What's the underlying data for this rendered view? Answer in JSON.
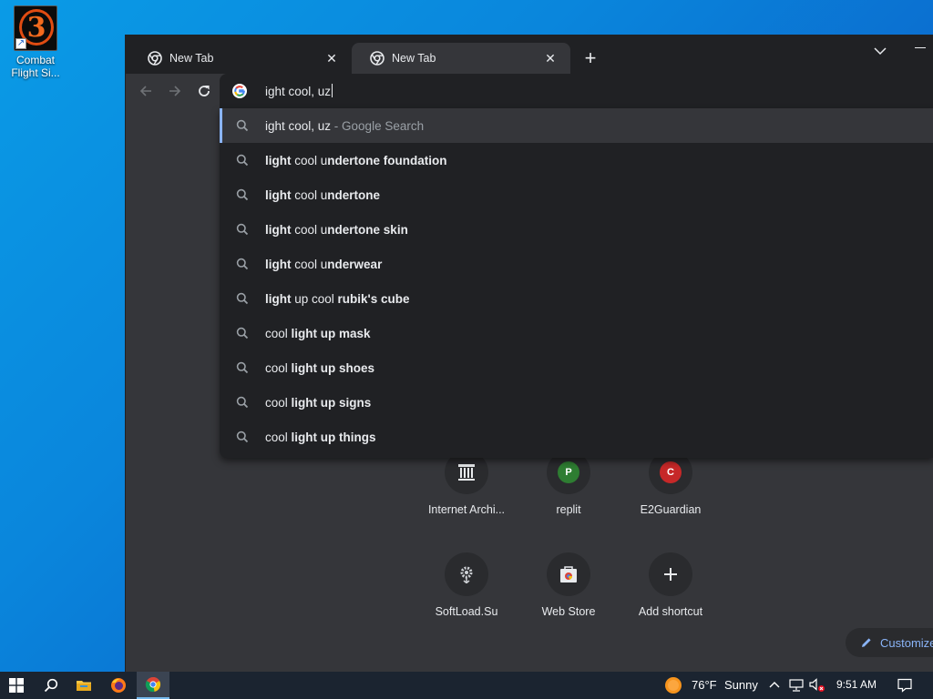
{
  "desktop": {
    "icon": {
      "glyph": "3",
      "label": "Combat Flight Si..."
    }
  },
  "tabs": [
    {
      "title": "New Tab",
      "active": false
    },
    {
      "title": "New Tab",
      "active": true
    }
  ],
  "tabstrip": {
    "new_tab_glyph": "+",
    "close_glyph": "✕"
  },
  "omnibox": {
    "value": "ight cool, uz"
  },
  "suggestions": {
    "first": {
      "query": "ight cool, uz",
      "suffix": " - Google Search"
    },
    "items": [
      {
        "parts": [
          [
            "light",
            true
          ],
          [
            " cool ",
            false
          ],
          [
            "u",
            false
          ],
          [
            "ndertone foundation",
            true
          ]
        ]
      },
      {
        "parts": [
          [
            "light",
            true
          ],
          [
            " cool ",
            false
          ],
          [
            "u",
            false
          ],
          [
            "ndertone",
            true
          ]
        ]
      },
      {
        "parts": [
          [
            "light",
            true
          ],
          [
            " cool ",
            false
          ],
          [
            "u",
            false
          ],
          [
            "ndertone skin",
            true
          ]
        ]
      },
      {
        "parts": [
          [
            "light",
            true
          ],
          [
            " cool ",
            false
          ],
          [
            "u",
            false
          ],
          [
            "nderwear",
            true
          ]
        ]
      },
      {
        "parts": [
          [
            "light",
            true
          ],
          [
            " up cool ",
            false
          ],
          [
            "rubik's cube",
            true
          ]
        ]
      },
      {
        "parts": [
          [
            "cool ",
            false
          ],
          [
            "light up mask",
            true
          ]
        ]
      },
      {
        "parts": [
          [
            "cool ",
            false
          ],
          [
            "light up shoes",
            true
          ]
        ]
      },
      {
        "parts": [
          [
            "cool ",
            false
          ],
          [
            "light up signs",
            true
          ]
        ]
      },
      {
        "parts": [
          [
            "cool ",
            false
          ],
          [
            "light up things",
            true
          ]
        ]
      }
    ]
  },
  "shortcuts": [
    {
      "name": "Internet Archi...",
      "icon": "archive-icon"
    },
    {
      "name": "replit",
      "icon": "letter-badge",
      "letter": "P",
      "color": "#2e7d32"
    },
    {
      "name": "E2Guardian",
      "icon": "letter-badge",
      "letter": "C",
      "color": "#c62828"
    },
    {
      "name": "SoftLoad.Su",
      "icon": "gear-icon"
    },
    {
      "name": "Web Store",
      "icon": "webstore-icon"
    },
    {
      "name": "Add shortcut",
      "icon": "plus-icon"
    }
  ],
  "customize": {
    "label": "Customize"
  },
  "taskbar": {
    "weather": {
      "temp": "76°F",
      "condition": "Sunny"
    },
    "time": "9:51 AM"
  },
  "colors": {
    "accent": "#8ab4f8",
    "chrome_dark": "#202124",
    "chrome_surface": "#35363a"
  }
}
